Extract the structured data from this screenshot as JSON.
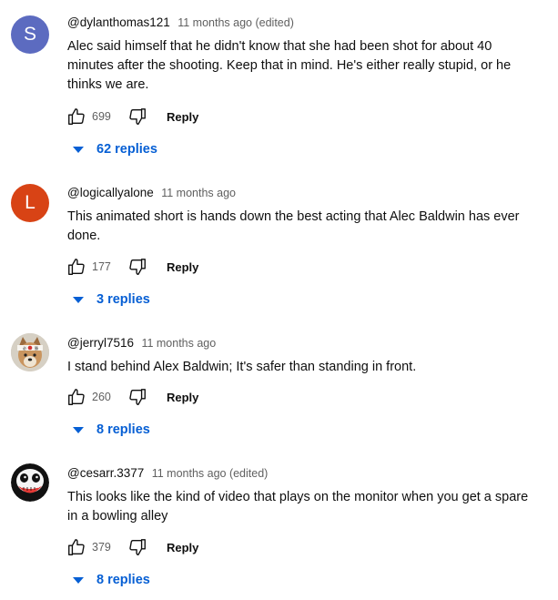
{
  "comments": [
    {
      "author": "@dylanthomas121",
      "meta": "11 months ago (edited)",
      "avatar_letter": "S",
      "avatar_color": "#5c6bc0",
      "text": "Alec said himself that he didn't know that she had been shot for about 40 minutes after the shooting. Keep that in mind. He's either really stupid, or he thinks we are.",
      "likes": "699",
      "reply_label": "Reply",
      "replies_label": "62 replies"
    },
    {
      "author": "@logicallyalone",
      "meta": "11 months ago",
      "avatar_letter": "L",
      "avatar_color": "#d84315",
      "text": "This animated short is hands down the best acting that Alec Baldwin has ever done.",
      "likes": "177",
      "reply_label": "Reply",
      "replies_label": "3 replies"
    },
    {
      "author": "@jerryl7516",
      "meta": "11 months ago",
      "avatar_icon": "dog-with-headband-avatar",
      "text": "I stand behind Alex Baldwin; It's safer than standing in front.",
      "likes": "260",
      "reply_label": "Reply",
      "replies_label": "8 replies"
    },
    {
      "author": "@cesarr.3377",
      "meta": "11 months ago (edited)",
      "avatar_icon": "skull-face-avatar",
      "text": "This looks like the kind of video that plays on the monitor when you get a spare in a bowling alley",
      "likes": "379",
      "reply_label": "Reply",
      "replies_label": "8 replies"
    }
  ],
  "colors": {
    "link_blue": "#065fd4",
    "meta_gray": "#606060",
    "text": "#0f0f0f"
  },
  "icons": {
    "like": "thumbs-up-icon",
    "dislike": "thumbs-down-icon",
    "expand": "caret-down-icon"
  }
}
